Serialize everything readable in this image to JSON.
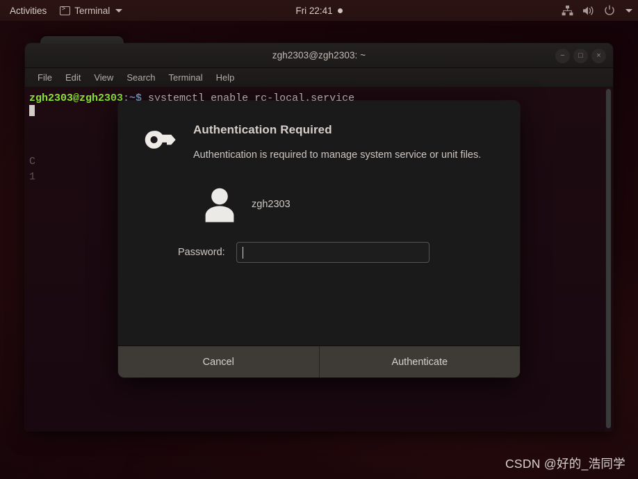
{
  "topbar": {
    "activities_label": "Activities",
    "app_name": "Terminal",
    "app_icon": "terminal-icon",
    "clock": "Fri 22:41",
    "indicator_icon": "recording-dot-icon",
    "tray_icons": [
      "wired-network-icon",
      "volume-icon",
      "power-icon",
      "chevron-down-icon"
    ],
    "bar_color": "#2a1312",
    "text_color": "#cfc6c2"
  },
  "terminal_window": {
    "title": "zgh2303@zgh2303: ~",
    "window_buttons": [
      {
        "name": "minimize-button",
        "glyph": "−"
      },
      {
        "name": "maximize-button",
        "glyph": "□"
      },
      {
        "name": "close-button",
        "glyph": "×"
      }
    ],
    "menu_items": [
      "File",
      "Edit",
      "View",
      "Search",
      "Terminal",
      "Help"
    ],
    "prompt_user": "zgh2303@zgh2303",
    "prompt_path": ":~$",
    "command": " systemctl enable rc-local.service",
    "obscured_output_lines": [
      "C",
      "1"
    ],
    "background_color": "#1c0a10",
    "prompt_user_color": "#8ae234",
    "prompt_path_color": "#729fcf"
  },
  "auth_dialog": {
    "icon": "key-icon",
    "title": "Authentication Required",
    "message": "Authentication is required to manage system service or unit files.",
    "user": {
      "avatar_icon": "user-avatar-icon",
      "name": "zgh2303"
    },
    "password": {
      "label": "Password:",
      "value": "",
      "placeholder": ""
    },
    "buttons": {
      "cancel_label": "Cancel",
      "authenticate_label": "Authenticate"
    },
    "body_color": "#1a1a1a",
    "button_bar_color": "#3e3b37"
  },
  "watermark": {
    "text": "CSDN @好的_浩同学"
  }
}
